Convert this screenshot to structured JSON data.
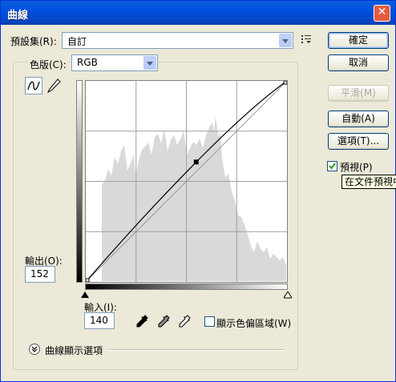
{
  "window": {
    "title": "曲線"
  },
  "preset": {
    "label": "預設集(R):",
    "value": "自訂"
  },
  "channel": {
    "label": "色版(C):",
    "value": "RGB"
  },
  "buttons": {
    "ok": "確定",
    "cancel": "取消",
    "smooth": "平滑(M)",
    "auto": "自動(A)",
    "options": "選項(T)..."
  },
  "preview": {
    "label": "預視(P)",
    "checked": true
  },
  "tooltip": "在文件預視中",
  "output": {
    "label": "輸出(O):",
    "value": "152"
  },
  "input": {
    "label": "輸入(I):",
    "value": "140"
  },
  "clipping": {
    "label": "顯示色偏區域(W)",
    "checked": false
  },
  "curve_options": {
    "label": "曲線顯示選項"
  },
  "curve": {
    "control_point": {
      "input": 140,
      "output": 152
    }
  },
  "icons": {
    "curve_tool": "curve-tool-icon",
    "pencil_tool": "pencil-icon",
    "preset_menu": "preset-menu-icon",
    "eyedroppers": [
      "black-eyedropper-icon",
      "gray-eyedropper-icon",
      "white-eyedropper-icon"
    ],
    "expand": "chevron-down-icon"
  }
}
